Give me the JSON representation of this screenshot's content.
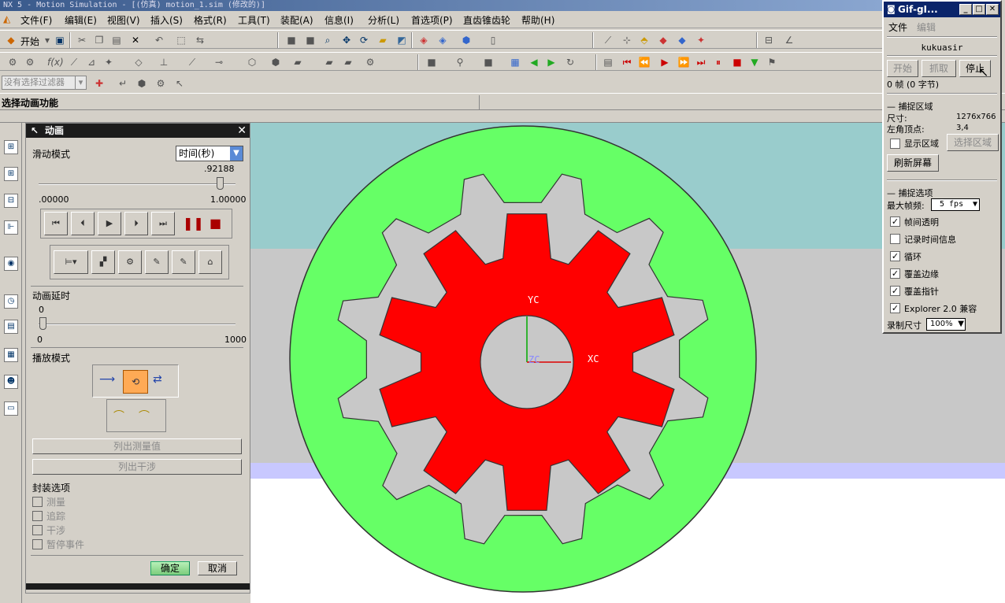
{
  "window_title": "NX 5 - Motion Simulation - [(仿真) motion_1.sim (修改的)]",
  "menu": [
    "文件(F)",
    "编辑(E)",
    "视图(V)",
    "插入(S)",
    "格式(R)",
    "工具(T)",
    "装配(A)",
    "信息(I)",
    "分析(L)",
    "首选项(P)",
    "直齿锥齿轮",
    "帮助(H)"
  ],
  "toolbar": {
    "start_label": "开始"
  },
  "filter": {
    "placeholder": "没有选择过滤器"
  },
  "status": {
    "prompt": "选择动画功能"
  },
  "panel": {
    "title": "动画",
    "slide_mode_label": "滑动模式",
    "slide_mode_value": "时间(秒)",
    "slider_value": ".92188",
    "slider_value_fraction": 0.92188,
    "slider_min": ".00000",
    "slider_max": "1.00000",
    "delay_label": "动画延时",
    "delay_value": "0",
    "delay_min": "0",
    "delay_max": "1000",
    "play_mode_label": "播放模式",
    "list_measure": "列出测量值",
    "list_interference": "列出干涉",
    "package_options_label": "封装选项",
    "options": [
      "测量",
      "追踪",
      "干涉",
      "暂停事件"
    ],
    "ok": "确定",
    "cancel": "取消"
  },
  "viewport": {
    "yc": "YC",
    "xc": "XC",
    "zc": "ZC",
    "colors": {
      "ring": "#66ff66",
      "gear": "#ff0000",
      "bg_top": "#99cccc",
      "bg_mid": "#c8c8c8",
      "bg_bottom": "#ffffff",
      "band": "#c8c8ff"
    }
  },
  "gif": {
    "title": "Gif-gI...",
    "menu_file": "文件",
    "menu_edit": "编辑",
    "user": "kukuasir",
    "btn_start": "开始",
    "btn_grab": "抓取",
    "btn_stop": "停止",
    "frames": "0 帧 (0 字节)",
    "capture_area": "捕捉区域",
    "size_label": "尺寸:",
    "size_value": "1276x766",
    "corner_label": "左角顶点:",
    "corner_value": "3,4",
    "show_area": "显示区域",
    "select_area": "选择区域",
    "refresh": "刷新屏幕",
    "capture_options": "捕捉选项",
    "max_fps_label": "最大帧频:",
    "max_fps_value": "5 fps",
    "opts": [
      {
        "label": "帧间透明",
        "checked": true
      },
      {
        "label": "记录时间信息",
        "checked": false
      },
      {
        "label": "循环",
        "checked": true
      },
      {
        "label": "覆盖边缘",
        "checked": true
      },
      {
        "label": "覆盖指针",
        "checked": true
      },
      {
        "label": "Explorer 2.0 兼容",
        "checked": true
      }
    ],
    "record_size_label": "录制尺寸",
    "record_size_value": "100%"
  }
}
